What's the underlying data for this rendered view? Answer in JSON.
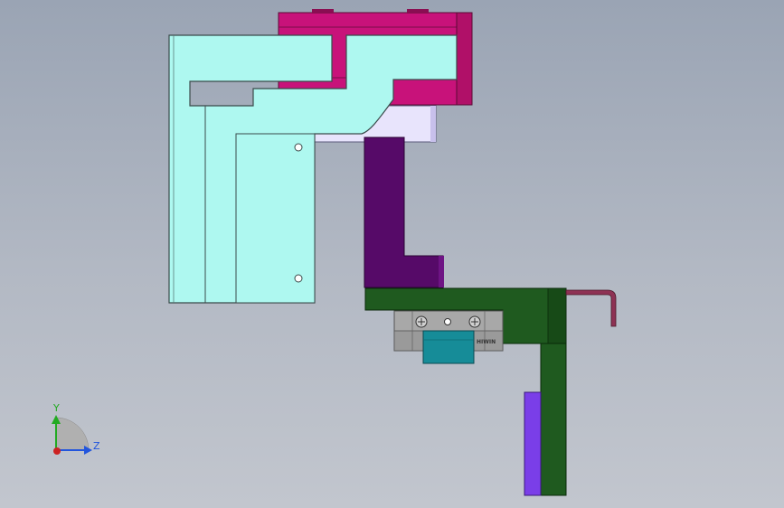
{
  "viewport": {
    "background_top": "#9aa4b4",
    "background_bottom": "#c2c6ce"
  },
  "triad": {
    "y_label": "Y",
    "z_label": "Z",
    "y_color": "#22aa22",
    "z_color": "#2255dd",
    "x_color": "#cc2222"
  },
  "parts": {
    "cyan_bracket": {
      "color": "#aef8f0",
      "edge": "#3a4a4a"
    },
    "magenta_block": {
      "color": "#c8127a",
      "edge": "#5a0a35"
    },
    "lavender_plate": {
      "color": "#e8e4fc"
    },
    "purple_arm": {
      "color": "#560a68"
    },
    "green_bracket": {
      "color": "#1f5a1f"
    },
    "rail_carriage": {
      "color": "#a8a8a8",
      "mark": "HIWIN"
    },
    "teal_rail": {
      "color": "#168c98"
    },
    "violet_plate": {
      "color": "#7a3ee8"
    },
    "hook_rod": {
      "color": "#8e3254"
    }
  }
}
